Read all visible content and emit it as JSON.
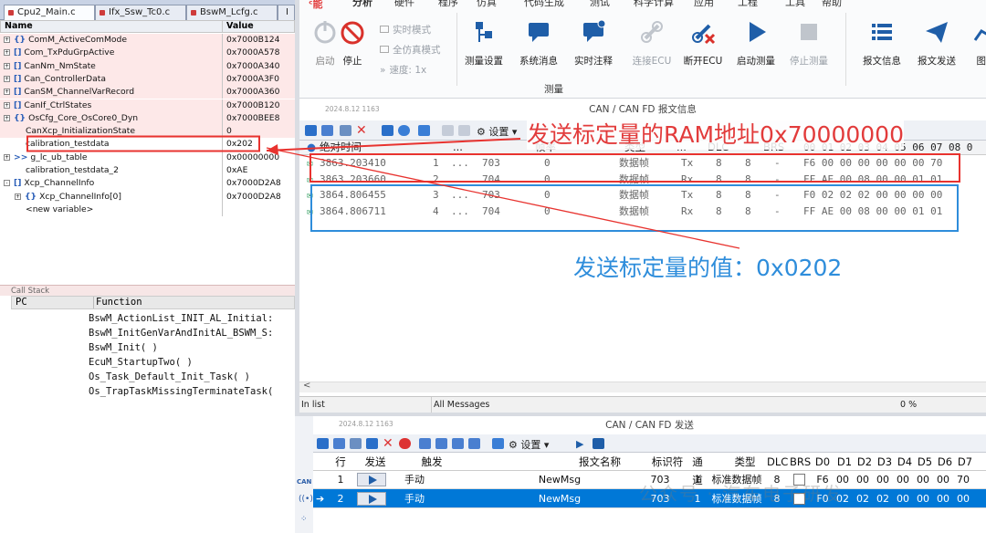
{
  "editor_tabs": [
    {
      "label": "Cpu2_Main.c"
    },
    {
      "label": "Ifx_Ssw_Tc0.c"
    },
    {
      "label": "BswM_Lcfg.c"
    },
    {
      "label": "I"
    }
  ],
  "watch": {
    "name_header": "Name",
    "value_header": "Value",
    "rows": [
      {
        "name": "ComM_ActiveComMode",
        "value": "0x7000B124",
        "expand": "+",
        "kind": "{}"
      },
      {
        "name": "Com_TxPduGrpActive",
        "value": "0x7000A578",
        "expand": "+",
        "kind": "[]"
      },
      {
        "name": "CanNm_NmState",
        "value": "0x7000A340",
        "expand": "+",
        "kind": "[]"
      },
      {
        "name": "Can_ControllerData",
        "value": "0x7000A3F0",
        "expand": "+",
        "kind": "[]"
      },
      {
        "name": "CanSM_ChannelVarRecord",
        "value": "0x7000A360",
        "expand": "+",
        "kind": "[]"
      },
      {
        "name": "CanIf_CtrlStates",
        "value": "0x7000B120",
        "expand": "+",
        "kind": "[]"
      },
      {
        "name": "OsCfg_Core_OsCore0_Dyn",
        "value": "0x7000BEE8",
        "expand": "+",
        "kind": "{}"
      },
      {
        "name": "CanXcp_InitializationState",
        "value": "0",
        "expand": "",
        "kind": ""
      },
      {
        "name": "calibration_testdata",
        "value": "0x202",
        "expand": "",
        "kind": ""
      },
      {
        "name": "g_lc_ub_table",
        "value": "0x00000000",
        "expand": "+",
        "kind": ">>"
      },
      {
        "name": "calibration_testdata_2",
        "value": "0xAE",
        "expand": "",
        "kind": ""
      },
      {
        "name": "Xcp_ChannelInfo",
        "value": "0x7000D2A8",
        "expand": "-",
        "kind": "[]"
      },
      {
        "name": "Xcp_ChannelInfo[0]",
        "value": "0x7000D2A8",
        "expand": "+",
        "kind": "{}"
      },
      {
        "name": "<new variable>",
        "value": "",
        "expand": "",
        "kind": ""
      }
    ]
  },
  "callstack": {
    "title": "Call Stack",
    "pc_header": "PC",
    "function_header": "Function",
    "frames": [
      "BswM_ActionList_INIT_AL_Initial:",
      "BswM_InitGenVarAndInitAL_BSWM_S:",
      "BswM_Init(  )",
      "EcuM_StartupTwo(  )",
      "Os_Task_Default_Init_Task(  )",
      "Os_TrapTaskMissingTerminateTask("
    ]
  },
  "ribbon": {
    "tabs": [
      "分析",
      "硬件",
      "程序",
      "仿真",
      "代码生成",
      "测试",
      "科学计算",
      "应用",
      "工程",
      "工具",
      "帮助"
    ],
    "logo": "ᶜ能",
    "start": "启动",
    "stop": "停止",
    "realtime": "实时模式",
    "fullsim": "全仿真模式",
    "speed": "速度: 1x",
    "buttons": [
      "测量设置",
      "系统消息",
      "实时注释",
      "连接ECU",
      "断开ECU",
      "启动测量",
      "停止测量",
      "报文信息",
      "报文发送",
      "图形"
    ],
    "group": "测量"
  },
  "msg_window": {
    "date": "2024.8.12 1163",
    "title": "CAN / CAN FD 报文信息",
    "settings": "设置",
    "header": {
      "time": "绝对时间",
      "dots": "...",
      "id": "帧率",
      "type": "类型",
      "dots2": "...",
      "dlc": "DLC",
      "brs": "BRS",
      "bytes": "00 01 02 03 04 05 06 07 08 0"
    },
    "rows": [
      {
        "time": "3863.203410",
        "n": "1",
        "dots": "...",
        "id": "703",
        "rate": "0",
        "type": "数据帧",
        "dir": "Tx",
        "dlc": "8",
        "dl": "8",
        "brs": "-",
        "data": "F6 00 00 00 00 00 00 70"
      },
      {
        "time": "3863.203660",
        "n": "2",
        "dots": "...",
        "id": "704",
        "rate": "0",
        "type": "数据帧",
        "dir": "Rx",
        "dlc": "8",
        "dl": "8",
        "brs": "-",
        "data": "FF AE 00 08 00 00 01 01"
      },
      {
        "time": "3864.806455",
        "n": "3",
        "dots": "...",
        "id": "703",
        "rate": "0",
        "type": "数据帧",
        "dir": "Tx",
        "dlc": "8",
        "dl": "8",
        "brs": "-",
        "data": "F0 02 02 02 00 00 00 00"
      },
      {
        "time": "3864.806711",
        "n": "4",
        "dots": "...",
        "id": "704",
        "rate": "0",
        "type": "数据帧",
        "dir": "Rx",
        "dlc": "8",
        "dl": "8",
        "brs": "-",
        "data": "FF AE 00 08 00 00 01 01"
      }
    ]
  },
  "status": {
    "left": "In list",
    "middle": "All Messages",
    "right": "0 %"
  },
  "send_window": {
    "date": "2024.8.12 1163",
    "title": "CAN / CAN FD 发送",
    "settings": "设置",
    "headers": [
      "行",
      "发送",
      "触发",
      "报文名称",
      "标识符",
      "通道",
      "类型",
      "DLC",
      "BRS",
      "D0",
      "D1",
      "D2",
      "D3",
      "D4",
      "D5",
      "D6",
      "D7"
    ],
    "rows": [
      {
        "row": "1",
        "trigger": "手动",
        "name": "NewMsg",
        "id": "703",
        "ch": "1",
        "type": "标准数据帧",
        "dlc": "8",
        "d": [
          "F6",
          "00",
          "00",
          "00",
          "00",
          "00",
          "00",
          "70"
        ]
      },
      {
        "row": "2",
        "trigger": "手动",
        "name": "NewMsg",
        "id": "703",
        "ch": "1",
        "type": "标准数据帧",
        "dlc": "8",
        "d": [
          "F0",
          "02",
          "02",
          "02",
          "00",
          "00",
          "00",
          "00"
        ]
      }
    ]
  },
  "annotations": {
    "ram_address": "发送标定量的RAM地址0x70000000",
    "value": "发送标定量的值：0x0202"
  },
  "watermark": "公众号 · 汽车电子研发"
}
